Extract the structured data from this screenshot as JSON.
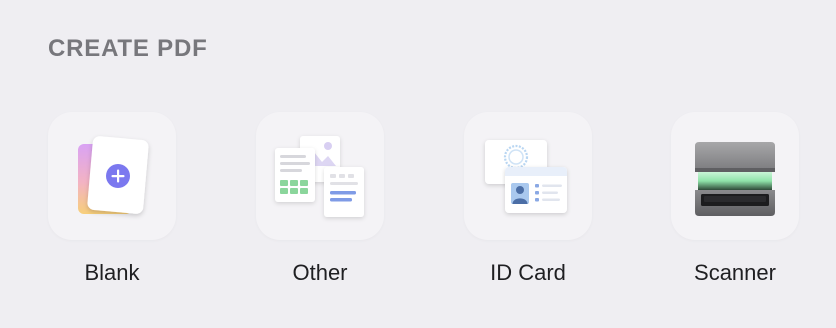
{
  "section": {
    "title": "CREATE PDF"
  },
  "tiles": [
    {
      "label": "Blank",
      "icon": "blank-document-plus-icon"
    },
    {
      "label": "Other",
      "icon": "other-documents-icon"
    },
    {
      "label": "ID Card",
      "icon": "id-card-icon"
    },
    {
      "label": "Scanner",
      "icon": "scanner-icon"
    }
  ],
  "colors": {
    "background": "#efeef2",
    "tile_background": "#f4f3f6",
    "title_text": "#77777c",
    "label_text": "#1f1f22",
    "accent_plus": "#7b78ef"
  }
}
